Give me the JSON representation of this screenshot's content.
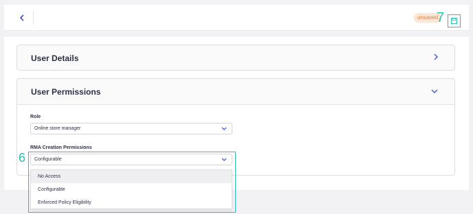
{
  "topbar": {
    "back_icon": "chevron-left-icon",
    "unsaved_label": "unsaved",
    "save_icon": "save-icon"
  },
  "callouts": {
    "step7": "7",
    "step6": "6"
  },
  "sections": {
    "user_details": {
      "title": "User Details",
      "icon": "chevron-right-icon"
    },
    "user_permissions": {
      "title": "User Permissions",
      "icon": "chevron-down-icon"
    }
  },
  "form": {
    "role": {
      "label": "Role",
      "value": "Online store manager"
    },
    "rma": {
      "label": "RMA Creation Permissions",
      "value": "Configurable",
      "options": [
        "No Access",
        "Configurable",
        "Enforced Policy Eligibility"
      ],
      "hovered_option": "No Access"
    }
  },
  "colors": {
    "accent": "#4257d6",
    "teal": "#2cc0b0",
    "badge_bg": "#fde6d6",
    "badge_text": "#e2833e"
  }
}
